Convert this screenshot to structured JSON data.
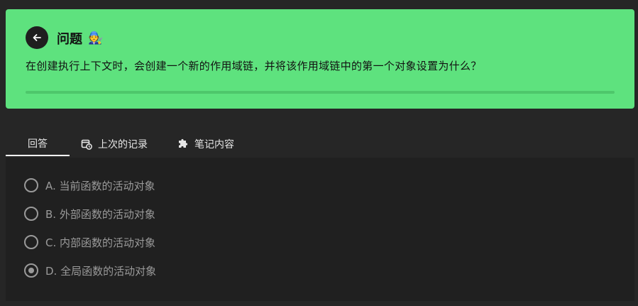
{
  "question": {
    "title": "问题",
    "title_emoji": "🧑‍🔧",
    "text": "在创建执行上下文时，会创建一个新的作用域链，并将该作用域链中的第一个对象设置为什么？",
    "back_icon": "arrow-left-icon"
  },
  "tabs": [
    {
      "label": "回答",
      "icon": ""
    },
    {
      "label": "上次的记录",
      "icon": "calendar-clock-icon"
    },
    {
      "label": "笔记内容",
      "icon": "puzzle-icon"
    }
  ],
  "options": [
    {
      "label": "A. 当前函数的活动对象",
      "selected": false
    },
    {
      "label": "B. 外部函数的活动对象",
      "selected": false
    },
    {
      "label": "C. 内部函数的活动对象",
      "selected": false
    },
    {
      "label": "D. 全局函数的活动对象",
      "selected": true
    }
  ],
  "colors": {
    "card_bg": "#5ee27e",
    "page_bg": "#262626",
    "panel_bg": "#202020",
    "option_text": "#9a9a9a"
  }
}
